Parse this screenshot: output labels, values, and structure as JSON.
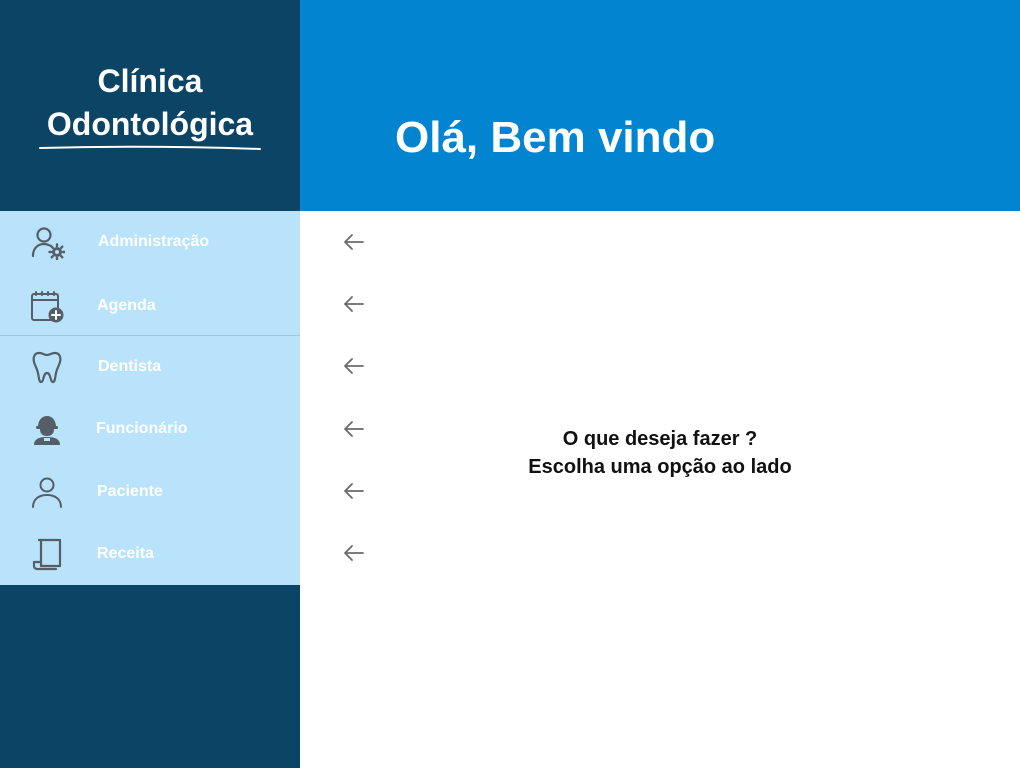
{
  "brand": {
    "title_line1": "Clínica",
    "title_line2": "Odontológica"
  },
  "header": {
    "title": "Olá, Bem vindo"
  },
  "menu": {
    "items": [
      {
        "label": "Administração",
        "icon": "user-gear-icon"
      },
      {
        "label": "Agenda",
        "icon": "calendar-add-icon"
      },
      {
        "label": "Dentista",
        "icon": "tooth-icon"
      },
      {
        "label": "Funcionário",
        "icon": "worker-icon"
      },
      {
        "label": "Paciente",
        "icon": "person-icon"
      },
      {
        "label": "Receita",
        "icon": "prescription-icon"
      }
    ]
  },
  "main": {
    "prompt_line1": "O que deseja fazer ?",
    "prompt_line2": "Escolha uma opção ao lado"
  },
  "colors": {
    "sidebar": "#0b4465",
    "menu": "#b8e3fb",
    "header": "#0284d0",
    "icon": "#555e66",
    "arrow": "#6b6b6b"
  }
}
